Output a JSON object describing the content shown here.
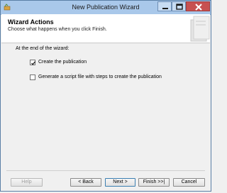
{
  "window": {
    "title": "New Publication Wizard"
  },
  "header": {
    "title": "Wizard Actions",
    "subtitle": "Choose what happens when you click Finish."
  },
  "content": {
    "intro_label": "At the end of the wizard:",
    "options": [
      {
        "label": "Create the publication",
        "checked": true
      },
      {
        "label": "Generate a script file with steps to create the publication",
        "checked": false
      }
    ]
  },
  "buttons": {
    "help": "Help",
    "back": "< Back",
    "next": "Next >",
    "finish": "Finish >>|",
    "cancel": "Cancel"
  },
  "icons": {
    "app": "app-icon",
    "minimize": "minimize-icon",
    "maximize": "maximize-icon",
    "close": "close-icon",
    "header_graphic": "wizard-graphic-icon"
  },
  "colors": {
    "titlebar": "#a9c8ea",
    "close_button": "#c75050",
    "default_button_border": "#3c7fb1"
  }
}
